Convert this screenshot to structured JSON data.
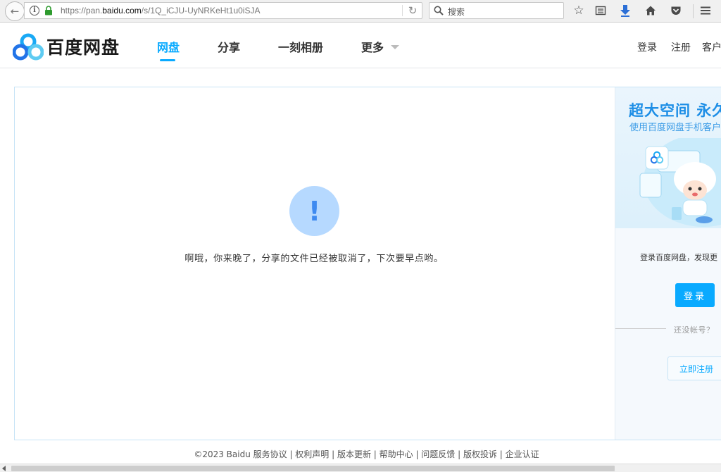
{
  "browser": {
    "url_prefix": "https://pan.",
    "url_host": "baidu.com",
    "url_path": "/s/1Q_iCJU-UyNRKeHt1u0iSJA",
    "search_placeholder": "搜索",
    "icons": [
      "back-arrow-icon",
      "info-icon",
      "lock-icon",
      "reload-icon",
      "search-icon",
      "star-icon",
      "reading-list-icon",
      "download-icon",
      "home-icon",
      "pocket-icon",
      "menu-icon"
    ]
  },
  "header": {
    "brand": "百度网盘",
    "nav": [
      {
        "label": "网盘",
        "active": true
      },
      {
        "label": "分享",
        "active": false
      },
      {
        "label": "一刻相册",
        "active": false
      },
      {
        "label": "更多",
        "active": false
      }
    ],
    "links": [
      "登录",
      "注册",
      "客户"
    ]
  },
  "main": {
    "alert_glyph": "!",
    "message": "啊哦，你来晚了，分享的文件已经被取消了，下次要早点哟。"
  },
  "side": {
    "promo_title": "超大空间  永久",
    "promo_sub": "使用百度网盘手机客户",
    "login_prompt": "登录百度网盘，发现更",
    "login_label": "登录",
    "no_account": "还没帐号？",
    "register_label": "立即注册"
  },
  "footer": {
    "text": "©2023 Baidu  服务协议 | 权利声明 | 版本更新 | 帮助中心 | 问题反馈 | 版权投诉 | 企业认证"
  },
  "colors": {
    "accent": "#09aaff",
    "alert_circle": "#b6d9ff",
    "alert_glyph": "#3e8af0",
    "card_border": "#c7e3f6"
  }
}
